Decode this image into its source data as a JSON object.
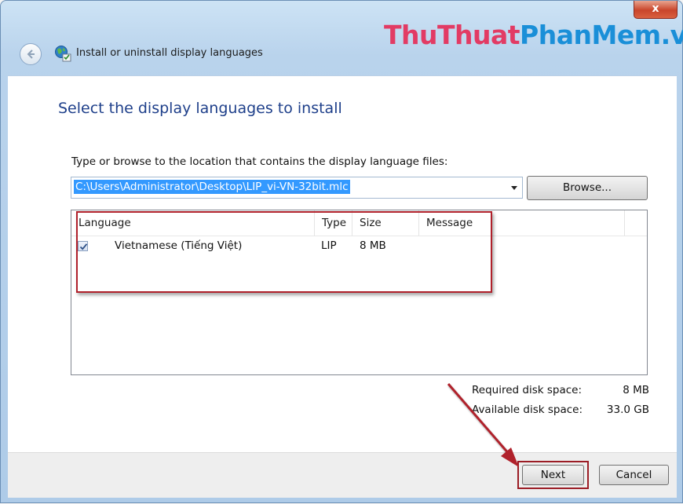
{
  "window": {
    "title": "Install or uninstall display languages",
    "close_label": "x",
    "watermark_part1": "ThuThuat",
    "watermark_part2": "PhanMem.vn"
  },
  "page": {
    "heading": "Select the display languages to install",
    "instruction": "Type or browse to the location that contains the display language files:",
    "path_value": "C:\\Users\\Administrator\\Desktop\\LIP_vi-VN-32bit.mlc",
    "browse_label": "Browse..."
  },
  "table": {
    "headers": [
      "Language",
      "Type",
      "Size",
      "Message"
    ],
    "rows": [
      {
        "checked": true,
        "language": "Vietnamese (Tiếng Việt)",
        "type": "LIP",
        "size": "8 MB",
        "message": ""
      }
    ]
  },
  "disk": {
    "required_label": "Required disk space:",
    "required_value": "8 MB",
    "available_label": "Available disk space:",
    "available_value": "33.0 GB"
  },
  "footer": {
    "next_label": "Next",
    "cancel_label": "Cancel"
  },
  "colors": {
    "annotation_red": "#b0212b",
    "heading_blue": "#1e3f8a",
    "selection_blue": "#3399ff"
  }
}
